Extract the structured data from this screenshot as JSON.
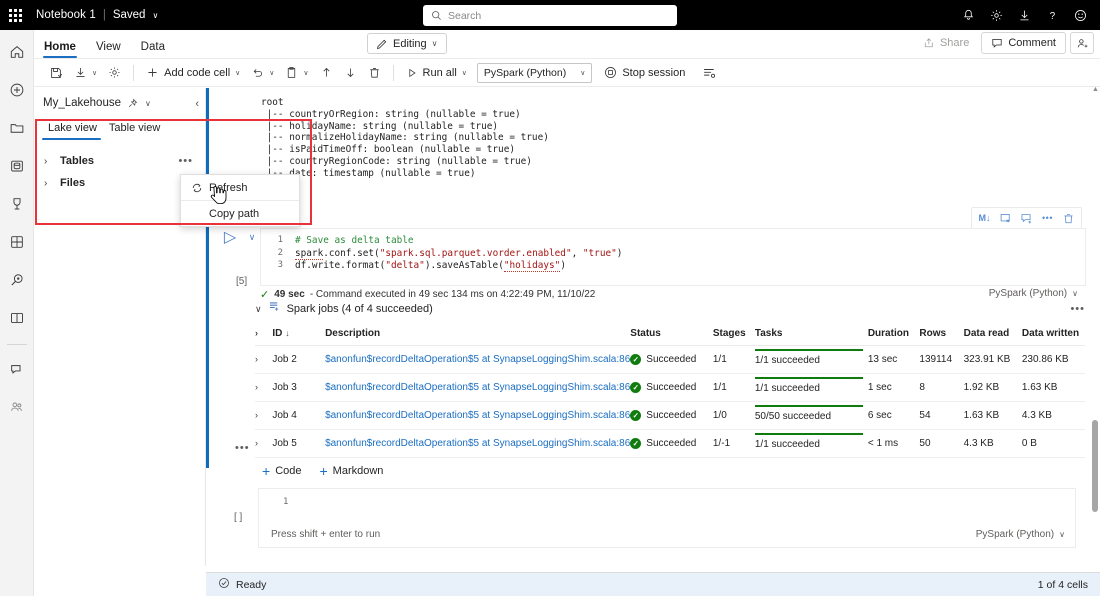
{
  "topbar": {
    "waffle_label": "app-launcher",
    "notebook_title": "Notebook 1",
    "separator": "|",
    "saved_label": "Saved",
    "caret": "∨",
    "search_placeholder": "Search",
    "icons": [
      "notification-bell",
      "settings-gear",
      "download",
      "help",
      "feedback-smiley"
    ]
  },
  "rail": {
    "items": [
      {
        "name": "home",
        "label": "Home"
      },
      {
        "name": "create",
        "label": "Create"
      },
      {
        "name": "browse",
        "label": "Browse"
      },
      {
        "name": "data-hub",
        "label": "OneLake data hub"
      },
      {
        "name": "metrics",
        "label": "Metrics"
      },
      {
        "name": "apps",
        "label": "Apps"
      },
      {
        "name": "deployment-pipelines",
        "label": "Deployment pipelines"
      },
      {
        "name": "learn",
        "label": "Learn"
      },
      {
        "name": "chat",
        "label": "Chat"
      },
      {
        "name": "workspaces",
        "label": "Workspaces"
      }
    ]
  },
  "ribbon": {
    "tabs": [
      {
        "label": "Home",
        "active": true
      },
      {
        "label": "View",
        "active": false
      },
      {
        "label": "Data",
        "active": false
      }
    ],
    "editing_label": "Editing",
    "editing_caret": "∨",
    "share_label": "Share",
    "comment_label": "Comment"
  },
  "toolbar": {
    "items": [
      {
        "name": "save-button",
        "label": ""
      },
      {
        "name": "download-button",
        "label": "",
        "caret": "∨"
      },
      {
        "name": "settings-button",
        "label": ""
      },
      {
        "name": "add-code-cell-button",
        "label": "Add code cell",
        "caret": "∨"
      },
      {
        "name": "undo-button",
        "label": "",
        "caret": "∨"
      },
      {
        "name": "clipboard-button",
        "label": "",
        "caret": "∨"
      },
      {
        "name": "move-up-button",
        "label": ""
      },
      {
        "name": "move-down-button",
        "label": ""
      },
      {
        "name": "delete-button",
        "label": ""
      },
      {
        "name": "run-all-button",
        "label": "Run all",
        "caret": "∨"
      }
    ],
    "add_code_cell_label": "Add code cell",
    "run_all_label": "Run all",
    "kernel_label": "PySpark (Python)",
    "kernel_caret": "∨",
    "stop_session_label": "Stop session",
    "outline_label": "View outline"
  },
  "lakehouse": {
    "name": "My_Lakehouse",
    "pin_icon": "pin-icon",
    "caret": "∨",
    "collapse_icon": "‹",
    "tabs": [
      {
        "label": "Lake view",
        "active": true
      },
      {
        "label": "Table view",
        "active": false
      }
    ],
    "tree": [
      {
        "label": "Tables",
        "chevron": "›",
        "ellipsis": "•••"
      },
      {
        "label": "Files",
        "chevron": "›",
        "ellipsis": ""
      }
    ],
    "context_menu": [
      {
        "label": "Refresh",
        "icon": "refresh-icon"
      },
      {
        "label": "Copy path",
        "icon": ""
      }
    ]
  },
  "notebook": {
    "schema_output": "root\n |-- countryOrRegion: string (nullable = true)\n |-- holidayName: string (nullable = true)\n |-- normalizeHolidayName: string (nullable = true)\n |-- isPaidTimeOff: boolean (nullable = true)\n |-- countryRegionCode: string (nullable = true)\n |-- date: timestamp (nullable = true)",
    "cell_toolbar": [
      {
        "name": "convert-to-markdown-icon",
        "glyph": "M↓"
      },
      {
        "name": "clear-output-icon",
        "glyph": ""
      },
      {
        "name": "add-comment-icon",
        "glyph": ""
      },
      {
        "name": "more-options-icon",
        "glyph": "•••"
      },
      {
        "name": "delete-cell-icon",
        "glyph": ""
      }
    ],
    "cell": {
      "run_icon": "▷",
      "chevron": "∨",
      "exec_count": "[5]",
      "code_lines": [
        {
          "n": "1",
          "segments": [
            {
              "t": "# Save as delta table",
              "c": "c-comment"
            }
          ]
        },
        {
          "n": "2",
          "segments": [
            {
              "t": "spark",
              "c": "c-under"
            },
            {
              "t": ".conf.set(",
              "c": ""
            },
            {
              "t": "\"spark.sql.parquet.vorder.enabled\"",
              "c": "c-str"
            },
            {
              "t": ", ",
              "c": ""
            },
            {
              "t": "\"true\"",
              "c": "c-str"
            },
            {
              "t": ")",
              "c": ""
            }
          ]
        },
        {
          "n": "3",
          "segments": [
            {
              "t": "df.write.format(",
              "c": ""
            },
            {
              "t": "\"delta\"",
              "c": "c-str"
            },
            {
              "t": ").saveAsTable(",
              "c": ""
            },
            {
              "t": "\"holidays\"",
              "c": "c-str"
            },
            {
              "t": ")",
              "c": ""
            }
          ]
        }
      ],
      "exec_duration": "49 sec",
      "exec_message": "- Command executed in 49 sec 134 ms on 4:22:49 PM, 11/10/22",
      "kernel_label": "PySpark (Python)",
      "kernel_caret": "∨"
    },
    "spark_jobs": {
      "chevron": "∨",
      "title": "Spark jobs (4 of 4 succeeded)",
      "ellipsis": "•••",
      "columns": [
        "",
        "ID",
        "Description",
        "Status",
        "Stages",
        "Tasks",
        "Duration",
        "Rows",
        "Data read",
        "Data written"
      ],
      "sort_arrow": "↓",
      "rows": [
        {
          "chevron": "›",
          "id": "Job 2",
          "description": "$anonfun$recordDeltaOperation$5 at SynapseLoggingShim.scala:86",
          "status": "Succeeded",
          "stages": "1/1",
          "tasks": "1/1 succeeded",
          "task_pct": 100,
          "duration": "13 sec",
          "rows": "139114",
          "data_read": "323.91 KB",
          "data_written": "230.86 KB"
        },
        {
          "chevron": "›",
          "id": "Job 3",
          "description": "$anonfun$recordDeltaOperation$5 at SynapseLoggingShim.scala:86",
          "status": "Succeeded",
          "stages": "1/1",
          "tasks": "1/1 succeeded",
          "task_pct": 100,
          "duration": "1 sec",
          "rows": "8",
          "data_read": "1.92 KB",
          "data_written": "1.63 KB"
        },
        {
          "chevron": "›",
          "id": "Job 4",
          "description": "$anonfun$recordDeltaOperation$5 at SynapseLoggingShim.scala:86",
          "status": "Succeeded",
          "stages": "1/0",
          "tasks": "50/50 succeeded",
          "task_pct": 100,
          "duration": "6 sec",
          "rows": "54",
          "data_read": "1.63 KB",
          "data_written": "4.3 KB"
        },
        {
          "chevron": "›",
          "id": "Job 5",
          "description": "$anonfun$recordDeltaOperation$5 at SynapseLoggingShim.scala:86",
          "status": "Succeeded",
          "stages": "1/-1",
          "tasks": "1/1 succeeded",
          "task_pct": 100,
          "duration": "< 1 ms",
          "rows": "50",
          "data_read": "4.3 KB",
          "data_written": "0 B"
        }
      ]
    },
    "mid_ellipsis": "•••",
    "add_buttons": [
      {
        "label": "Code",
        "plus": "+"
      },
      {
        "label": "Markdown",
        "plus": "+"
      }
    ],
    "empty_cell": {
      "gutter": "[ ]",
      "line_number": "1",
      "hint": "Press shift + enter to run",
      "kernel_label": "PySpark (Python)",
      "kernel_caret": "∨"
    }
  },
  "statusbar": {
    "status_icon": "check-circle-icon",
    "status_text": "Ready",
    "cell_count": "1 of 4 cells"
  },
  "colors": {
    "accent_blue": "#1b6ec2",
    "success_green": "#107c10",
    "highlight_red": "#e8333a",
    "statusbar_bg": "#e8f0fa",
    "topbar_bg": "#000000"
  }
}
